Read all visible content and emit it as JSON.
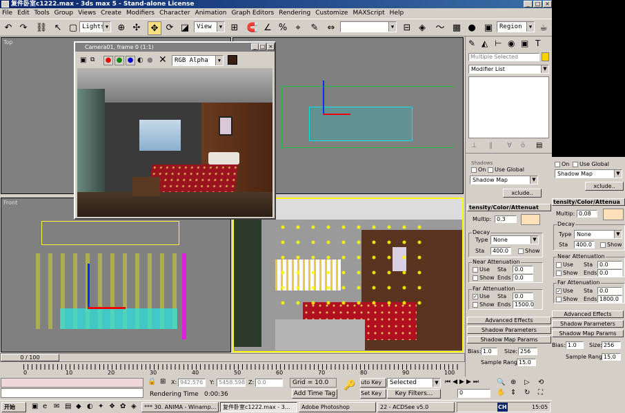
{
  "window": {
    "title": "复件卧室c1222.max - 3ds max 5 - Stand-alone License"
  },
  "menu": [
    "File",
    "Edit",
    "Tools",
    "Group",
    "Views",
    "Create",
    "Modifiers",
    "Character",
    "Animation",
    "Graph Editors",
    "Rendering",
    "Customize",
    "MAXScript",
    "Help"
  ],
  "toolbar": {
    "selection_filter": "Lights",
    "coord_system": "View",
    "named_sel": "",
    "region": "Region"
  },
  "viewports": {
    "top": "Top",
    "front": "Front"
  },
  "render_window": {
    "title": "Camera01, frame 0 (1:1)",
    "channel": "RGB Alpha"
  },
  "cmd_panel": {
    "selected": "Multiple Selected",
    "modifier_list": "Modifier List"
  },
  "shadows": {
    "header": "Shadows",
    "on": "On",
    "use_global": "Use Global",
    "type": "Shadow Map",
    "exclude": "xclude.."
  },
  "intensity": {
    "header": "tensity/Color/Attenuat",
    "multiplier_label": "Multip:",
    "multiplier": "0.3",
    "decay_label": "Decay",
    "type_label": "Type",
    "type": "None",
    "start_label": "Sta",
    "start": "400.0",
    "show": "Show"
  },
  "near_att": {
    "label": "Near Attenuation",
    "use": "Use",
    "show": "Show",
    "start_label": "Sta",
    "end_label": "Ends",
    "start": "0.0",
    "end": "0.0"
  },
  "far_att": {
    "label": "Far Attenuation",
    "use": "Use",
    "show": "Show",
    "start_label": "Sta",
    "end_label": "Ends",
    "start": "0.0",
    "end": "1500.0"
  },
  "rollups": {
    "advanced": "Advanced Effects",
    "shadow_params": "Shadow Parameters",
    "shadow_map": "Shadow Map Params"
  },
  "shadow_map": {
    "bias_label": "Bias:",
    "bias": "1.0",
    "size_label": "Size:",
    "size": "256",
    "sample_label": "Sample Range:",
    "sample": "15.0"
  },
  "float_panel": {
    "on": "On",
    "use_global": "Use Global",
    "type": "Shadow Map",
    "exclude": "xclude..",
    "header": "tensity/Color/Attenua",
    "multiplier_label": "Multip:",
    "multiplier": "0.08",
    "decay_label": "Decay",
    "type_label": "Type",
    "decay_type": "None",
    "start_label": "Sta",
    "start": "400.0",
    "show": "Show",
    "near": "Near Attenuation",
    "near_start": "0.0",
    "near_end": "0.0",
    "far": "Far Attenuation",
    "far_start": "0.0",
    "far_end": "1800.0",
    "use": "Use",
    "sta": "Sta",
    "ends": "Ends",
    "advanced": "Advanced Effects",
    "shadow_params": "Shadow Parameters",
    "shadow_map": "Shadow Map Params",
    "bias_label": "Bias:",
    "bias": "1.0",
    "size_label": "Size:",
    "size": "256",
    "sample_label": "Sample Range:",
    "sample": "15.0"
  },
  "timeline": {
    "frame": "0 / 100",
    "ticks": [
      "0",
      "10",
      "20",
      "30",
      "40",
      "50",
      "60",
      "70",
      "80",
      "90",
      "100"
    ]
  },
  "status": {
    "x_label": "X:",
    "x": "942.576",
    "y_label": "Y:",
    "y": "5458.598",
    "z_label": "Z:",
    "z": "0.0",
    "grid": "Grid = 10.0",
    "auto_key": "uto Key",
    "key_mode": "Selected",
    "render_time_label": "Rendering Time",
    "render_time": "0:00:36",
    "add_time_tag": "Add Time Tag",
    "set_key": "Set Key",
    "key_filters": "Key Filters...",
    "frame_field": "0"
  },
  "taskbar": {
    "start": "开始",
    "tasks": [
      "*** 30. ANIMA - Winamp...",
      "复件卧室c1222.max - 3...",
      "Adobe Photoshop",
      "22 - ACDSee v5.0"
    ],
    "lang": "CH",
    "clock": "15:05"
  },
  "colors": {
    "title_active": "#0a246a",
    "viewport_bg": "#808080",
    "chrome": "#d4d0c8",
    "active_border": "#ffff00"
  }
}
